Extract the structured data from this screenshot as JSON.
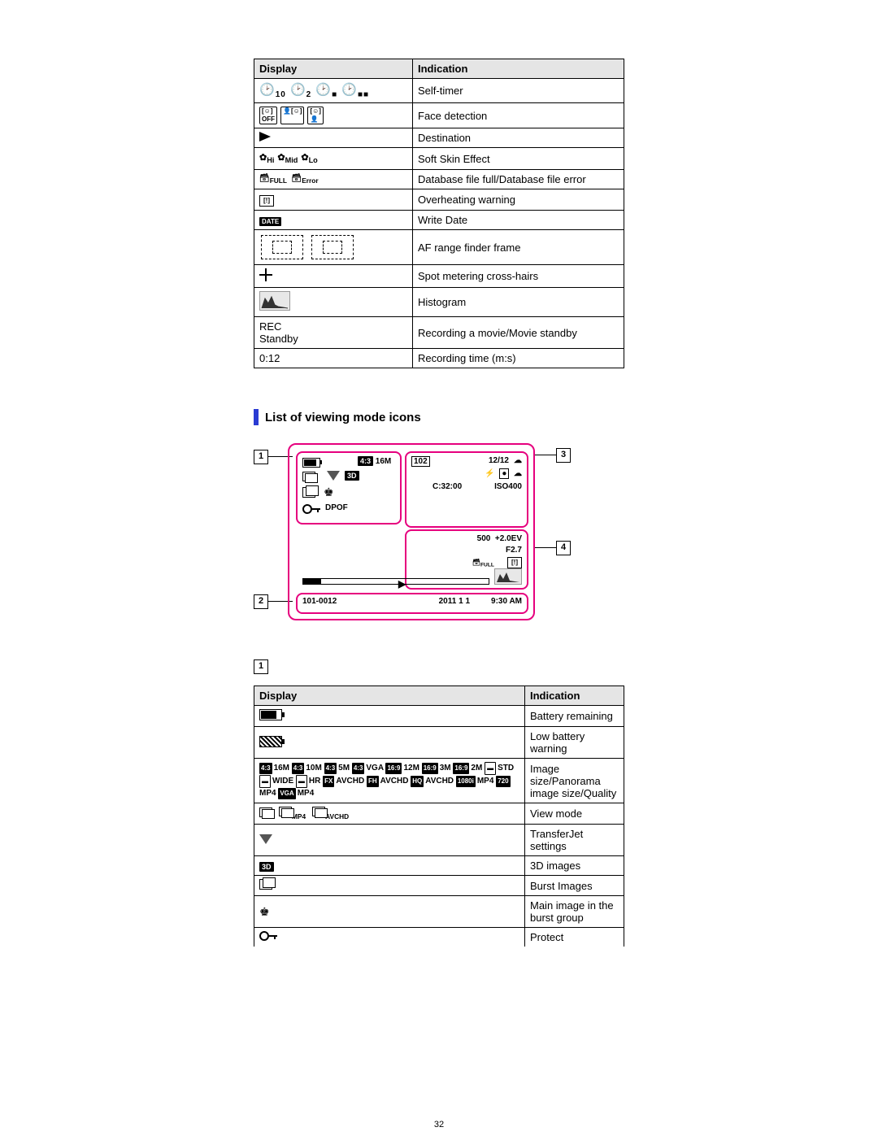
{
  "page_number": "32",
  "table1": {
    "headers": {
      "display": "Display",
      "indication": "Indication"
    },
    "rows": {
      "self_timer": {
        "display_text": "10  2",
        "indication": "Self-timer"
      },
      "face_detection": {
        "indication": "Face detection"
      },
      "destination": {
        "indication": "Destination"
      },
      "soft_skin": {
        "display_labels": [
          "Hi",
          "Mid",
          "Lo"
        ],
        "indication": "Soft Skin Effect"
      },
      "db": {
        "display_labels": [
          "FULL",
          "Error"
        ],
        "indication": "Database file full/Database file error"
      },
      "overheat": {
        "indication": "Overheating warning"
      },
      "write_date": {
        "display_text": "DATE",
        "indication": "Write Date"
      },
      "af": {
        "indication": "AF range finder frame"
      },
      "spot": {
        "indication": "Spot metering cross-hairs"
      },
      "histogram": {
        "indication": "Histogram"
      },
      "rec": {
        "display_text": "REC\nStandby",
        "indication": "Recording a movie/Movie standby"
      },
      "rectime": {
        "display_text": "0:12",
        "indication": "Recording time (m:s)"
      }
    }
  },
  "section_header": "List of viewing mode icons",
  "playback": {
    "region1": {
      "badge43": "4:3",
      "size": "16M",
      "threeD": "3D",
      "dpof": "DPOF"
    },
    "region3": {
      "folder": "102",
      "frame": "12/12",
      "counter": "C:32:00",
      "iso": "ISO400"
    },
    "region4": {
      "shutter": "500",
      "ev": "+2.0EV",
      "f": "F2.7",
      "full_label": "FULL"
    },
    "region2": {
      "file": "101-0012",
      "date": "2011 1 1",
      "time": "9:30 AM"
    },
    "callouts": {
      "c1": "1",
      "c2": "2",
      "c3": "3",
      "c4": "4"
    }
  },
  "section1_num": "1",
  "table2": {
    "headers": {
      "display": "Display",
      "indication": "Indication"
    },
    "rows": {
      "batt": {
        "indication": "Battery remaining"
      },
      "lowbatt": {
        "indication": "Low battery warning"
      },
      "sizes": {
        "line1": "4:3 16M 4:3 10M 4:3 5M 4:3 VGA 16:9 12M 16:9 3M 16:9 2M — STD",
        "line2": "WIDE — HR FX AVCHD FH AVCHD HQ AVCHD 1080i MP4 720 MP4 VGA MP4",
        "indication": "Image size/Panorama image size/Quality"
      },
      "viewmode": {
        "labels": [
          "MP4",
          "AVCHD"
        ],
        "indication": "View mode"
      },
      "transferjet": {
        "indication": "TransferJet settings"
      },
      "threeD": {
        "label": "3D",
        "indication": "3D images"
      },
      "burst": {
        "indication": "Burst Images"
      },
      "crown": {
        "indication": "Main image in the burst group"
      },
      "protect": {
        "indication": "Protect"
      }
    }
  }
}
